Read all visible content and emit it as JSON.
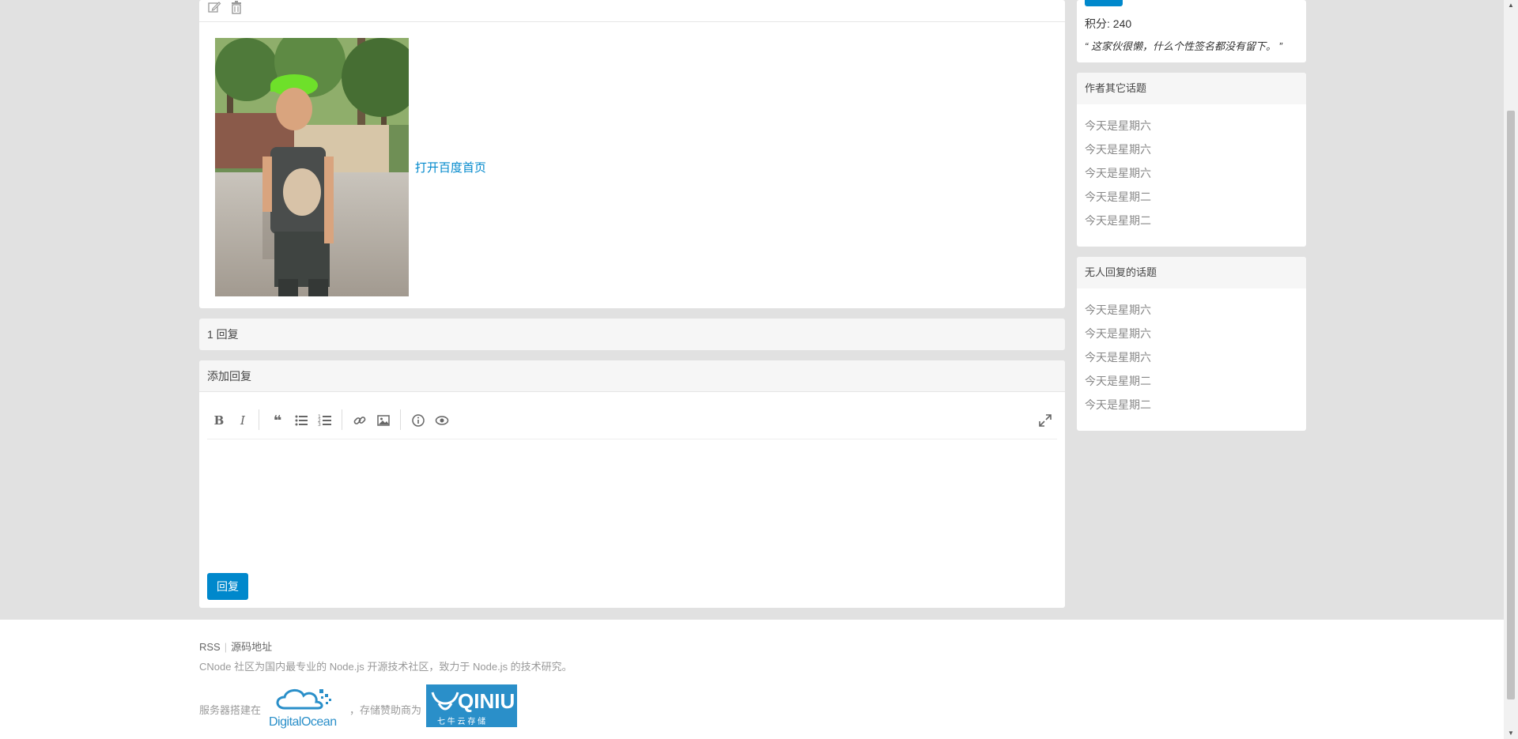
{
  "topic": {
    "link_text": "打开百度首页"
  },
  "replies": {
    "count_text": "1 回复"
  },
  "add_reply": {
    "title": "添加回复",
    "submit_label": "回复"
  },
  "author": {
    "score_text": "积分: 240",
    "signature": "“ 这家伙很懒，什么个性签名都没有留下。 ”"
  },
  "author_topics": {
    "title": "作者其它话题",
    "items": [
      "今天是星期六",
      "今天是星期六",
      "今天是星期六",
      "今天是星期二",
      "今天是星期二"
    ]
  },
  "no_reply_topics": {
    "title": "无人回复的话题",
    "items": [
      "今天是星期六",
      "今天是星期六",
      "今天是星期六",
      "今天是星期二",
      "今天是星期二"
    ]
  },
  "footer": {
    "rss": "RSS",
    "source": "源码地址",
    "description": "CNode 社区为国内最专业的 Node.js 开源技术社区，致力于 Node.js 的技术研究。",
    "server_text": "服务器搭建在",
    "storage_text": "，存储赞助商为",
    "do_logo_text": "DigitalOcean",
    "qiniu_logo_text": "QINIU",
    "qiniu_sub": "七 牛 云 存 储"
  },
  "colors": {
    "accent": "#0088cc",
    "background": "#e1e1e1"
  }
}
